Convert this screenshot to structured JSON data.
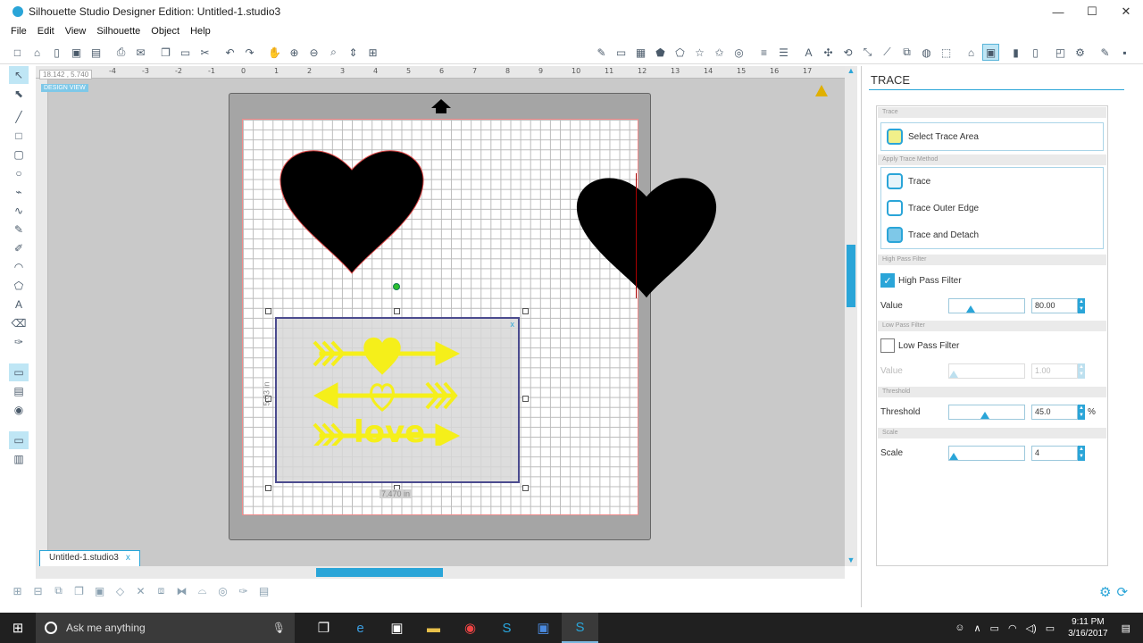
{
  "window": {
    "title": "Silhouette Studio Designer Edition: Untitled-1.studio3",
    "controls": [
      "—",
      "☐",
      "✕"
    ]
  },
  "menu": [
    "File",
    "Edit",
    "View",
    "Silhouette",
    "Object",
    "Help"
  ],
  "workspace": {
    "coords": "18.142 , 5.740",
    "design_view_badge": "DESIGN VIEW",
    "ruler_top": [
      "-4",
      "-3",
      "-2",
      "-1",
      "0",
      "1",
      "2",
      "3",
      "4",
      "5",
      "6",
      "7",
      "8",
      "9",
      "10",
      "11",
      "12",
      "13",
      "14",
      "15",
      "16",
      "17"
    ],
    "width_dim": "7.470 in",
    "height_dim": "5.03 in"
  },
  "tabs": [
    {
      "label": "Untitled-1.studio3",
      "close": "x"
    }
  ],
  "panel": {
    "title": "TRACE",
    "sections": {
      "trace": "Trace",
      "apply_method": "Apply Trace Method",
      "high_pass": "High Pass Filter",
      "low_pass": "Low Pass Filter",
      "threshold": "Threshold",
      "scale": "Scale"
    },
    "select_trace_area": "Select Trace Area",
    "methods": [
      "Trace",
      "Trace Outer Edge",
      "Trace and Detach"
    ],
    "high_pass": {
      "label": "High Pass Filter",
      "checked": true,
      "value_label": "Value",
      "value": "80.00"
    },
    "low_pass": {
      "label": "Low Pass Filter",
      "checked": false,
      "value_label": "Value",
      "value": "1.00"
    },
    "threshold": {
      "label": "Threshold",
      "value": "45.0",
      "unit": "%"
    },
    "scale": {
      "label": "Scale",
      "value": "4"
    },
    "accent": "#2aa5d8"
  },
  "taskbar": {
    "search_placeholder": "Ask me anything",
    "time": "9:11 PM",
    "date": "3/16/2017"
  }
}
